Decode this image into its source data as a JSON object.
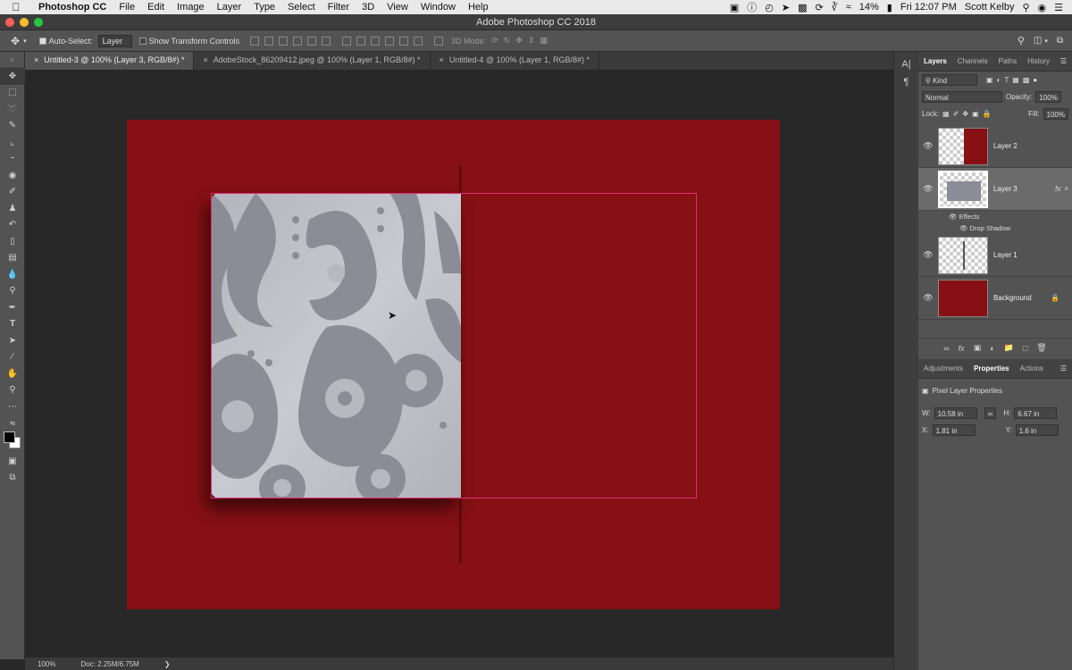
{
  "menubar": {
    "app": "Photoshop CC",
    "items": [
      "File",
      "Edit",
      "Image",
      "Layer",
      "Type",
      "Select",
      "Filter",
      "3D",
      "View",
      "Window",
      "Help"
    ],
    "battery": "14%",
    "clock": "Fri 12:07 PM",
    "user": "Scott Kelby"
  },
  "window_title": "Adobe Photoshop CC 2018",
  "options": {
    "auto_select_label": "Auto-Select:",
    "auto_select_value": "Layer",
    "transform_label": "Show Transform Controls",
    "mode3d": "3D Mode:"
  },
  "tabs": [
    "Untitled-3 @ 100% (Layer 3, RGB/8#) *",
    "AdobeStock_86209412.jpeg @ 100% (Layer 1, RGB/8#) *",
    "Untitled-4 @ 100% (Layer 1, RGB/8#) *"
  ],
  "status": {
    "zoom": "100%",
    "doc": "Doc: 2.25M/6.75M"
  },
  "panel": {
    "tabs": [
      "Layers",
      "Channels",
      "Paths",
      "History"
    ],
    "kind": "Kind",
    "blend_mode": "Normal",
    "opacity_label": "Opacity:",
    "opacity_value": "100%",
    "lock_label": "Lock:",
    "fill_label": "Fill:",
    "fill_value": "100%",
    "layers": [
      {
        "name": "Layer 2"
      },
      {
        "name": "Layer 3"
      },
      {
        "name": "Layer 1"
      },
      {
        "name": "Background"
      }
    ],
    "effects_label": "Effects",
    "drop_shadow_label": "Drop Shadow",
    "fx": "fx"
  },
  "properties": {
    "tabs": [
      "Adjustments",
      "Properties",
      "Actions"
    ],
    "title": "Pixel Layer Properties",
    "w_label": "W:",
    "w_value": "10.58 in",
    "h_label": "H:",
    "h_value": "6.67 in",
    "x_label": "X:",
    "x_value": "1.81 in",
    "y_label": "Y:",
    "y_value": "1.6 in"
  },
  "colors": {
    "canvas": "#861014",
    "accent": "#e0307a"
  }
}
